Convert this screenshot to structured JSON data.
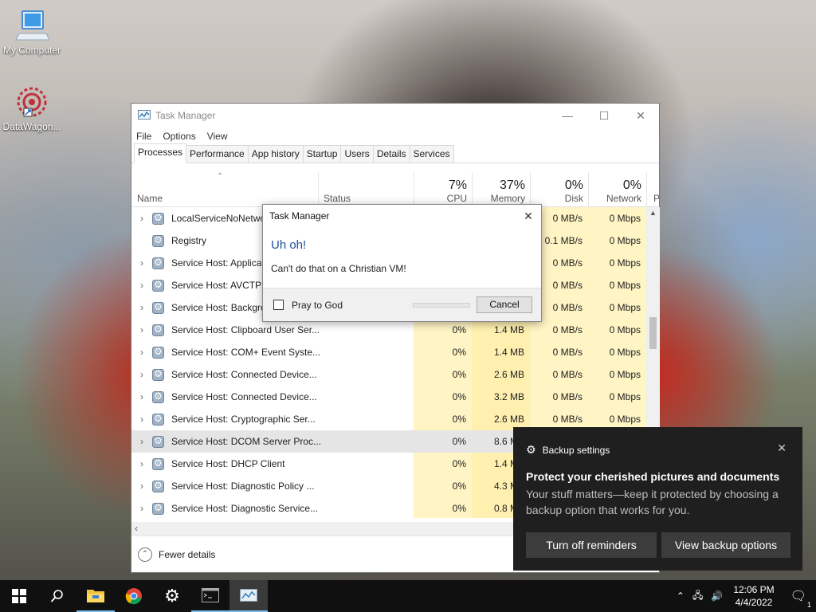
{
  "desktop": {
    "icons": [
      {
        "label": "My Computer",
        "icon": "computer-icon"
      },
      {
        "label": "DataWagon...",
        "icon": "datawagon-icon"
      }
    ]
  },
  "task_manager": {
    "title": "Task Manager",
    "menu": [
      "File",
      "Options",
      "View"
    ],
    "tabs": [
      "Processes",
      "Performance",
      "App history",
      "Startup",
      "Users",
      "Details",
      "Services"
    ],
    "active_tab": "Processes",
    "columns": {
      "name": "Name",
      "status": "Status",
      "cpu": {
        "pct": "7%",
        "label": "CPU"
      },
      "memory": {
        "pct": "37%",
        "label": "Memory"
      },
      "disk": {
        "pct": "0%",
        "label": "Disk"
      },
      "network": {
        "pct": "0%",
        "label": "Network"
      },
      "extra": "P"
    },
    "rows": [
      {
        "name": "LocalServiceNoNetwo",
        "cpu": "",
        "mem": "",
        "disk": "0 MB/s",
        "net": "0 Mbps",
        "expand": true
      },
      {
        "name": "Registry",
        "cpu": "",
        "mem": "",
        "disk": "0.1 MB/s",
        "net": "0 Mbps",
        "expand": false
      },
      {
        "name": "Service Host: Applicat",
        "cpu": "",
        "mem": "",
        "disk": "0 MB/s",
        "net": "0 Mbps",
        "expand": true
      },
      {
        "name": "Service Host: AVCTP s",
        "cpu": "",
        "mem": "",
        "disk": "0 MB/s",
        "net": "0 Mbps",
        "expand": true
      },
      {
        "name": "Service Host: Backgro",
        "cpu": "",
        "mem": "",
        "disk": "0 MB/s",
        "net": "0 Mbps",
        "expand": true
      },
      {
        "name": "Service Host: Clipboard User Ser...",
        "cpu": "0%",
        "mem": "1.4 MB",
        "disk": "0 MB/s",
        "net": "0 Mbps",
        "expand": true
      },
      {
        "name": "Service Host: COM+ Event Syste...",
        "cpu": "0%",
        "mem": "1.4 MB",
        "disk": "0 MB/s",
        "net": "0 Mbps",
        "expand": true
      },
      {
        "name": "Service Host: Connected Device...",
        "cpu": "0%",
        "mem": "2.6 MB",
        "disk": "0 MB/s",
        "net": "0 Mbps",
        "expand": true
      },
      {
        "name": "Service Host: Connected Device...",
        "cpu": "0%",
        "mem": "3.2 MB",
        "disk": "0 MB/s",
        "net": "0 Mbps",
        "expand": true
      },
      {
        "name": "Service Host: Cryptographic Ser...",
        "cpu": "0%",
        "mem": "2.6 MB",
        "disk": "0 MB/s",
        "net": "0 Mbps",
        "expand": true
      },
      {
        "name": "Service Host: DCOM Server Proc...",
        "cpu": "0%",
        "mem": "8.6 MB",
        "disk": "",
        "net": "",
        "expand": true,
        "selected": true
      },
      {
        "name": "Service Host: DHCP Client",
        "cpu": "0%",
        "mem": "1.4 MB",
        "disk": "",
        "net": "",
        "expand": true
      },
      {
        "name": "Service Host: Diagnostic Policy ...",
        "cpu": "0%",
        "mem": "4.3 MB",
        "disk": "",
        "net": "",
        "expand": true
      },
      {
        "name": "Service Host: Diagnostic Service...",
        "cpu": "0%",
        "mem": "0.8 MB",
        "disk": "",
        "net": "",
        "expand": true
      }
    ],
    "footer": "Fewer details"
  },
  "dialog": {
    "title": "Task Manager",
    "heading": "Uh oh!",
    "message": "Can't do that on a Christian VM!",
    "checkbox_label": "Pray to God",
    "cancel_label": "Cancel"
  },
  "toast": {
    "app": "Backup settings",
    "title": "Protect your cherished pictures and documents",
    "body": "Your stuff matters—keep it protected by choosing a backup option that works for you.",
    "button_left": "Turn off reminders",
    "button_right": "View backup options"
  },
  "taskbar": {
    "time": "12:06 PM",
    "date": "4/4/2022",
    "notification_count": "1"
  }
}
